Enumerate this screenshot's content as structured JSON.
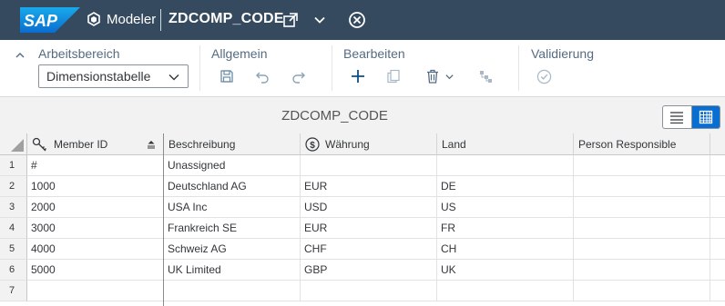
{
  "shell": {
    "logo_text": "SAP",
    "app_name": "Modeler",
    "document_name": "ZDCOMP_CODE",
    "icons": [
      "cube-icon",
      "popout-icon",
      "chevron-down-icon",
      "close-circle-icon"
    ],
    "colors": {
      "shell_bg": "#354a5f",
      "logo_blue": "#0a6ed1"
    }
  },
  "toolbar": {
    "groups": {
      "workspace": {
        "title": "Arbeitsbereich",
        "selected": "Dimensionstabelle"
      },
      "general": {
        "title": "Allgemein",
        "icons": [
          "save-icon",
          "undo-icon",
          "redo-icon"
        ]
      },
      "edit": {
        "title": "Bearbeiten",
        "icons": [
          "add-icon",
          "copy-icon",
          "delete-icon",
          "hierarchy-icon"
        ]
      },
      "validation": {
        "title": "Validierung",
        "icons": [
          "validate-icon"
        ]
      }
    }
  },
  "table": {
    "title": "ZDCOMP_CODE",
    "view_modes": [
      "list-view-icon",
      "grid-view-icon"
    ],
    "active_view": "grid",
    "columns": [
      "Member ID",
      "Beschreibung",
      "Währung",
      "Land",
      "Person Responsible"
    ],
    "rows": [
      {
        "num": "1",
        "cells": [
          "#",
          "Unassigned",
          "",
          "",
          ""
        ]
      },
      {
        "num": "2",
        "cells": [
          "1000",
          "Deutschland AG",
          "EUR",
          "DE",
          ""
        ]
      },
      {
        "num": "3",
        "cells": [
          "2000",
          "USA Inc",
          "USD",
          "US",
          ""
        ]
      },
      {
        "num": "4",
        "cells": [
          "3000",
          "Frankreich SE",
          "EUR",
          "FR",
          ""
        ]
      },
      {
        "num": "5",
        "cells": [
          "4000",
          "Schweiz AG",
          "CHF",
          "CH",
          ""
        ]
      },
      {
        "num": "6",
        "cells": [
          "5000",
          "UK Limited",
          "GBP",
          "UK",
          ""
        ]
      },
      {
        "num": "7",
        "cells": [
          "",
          "",
          "",
          "",
          ""
        ]
      }
    ]
  }
}
